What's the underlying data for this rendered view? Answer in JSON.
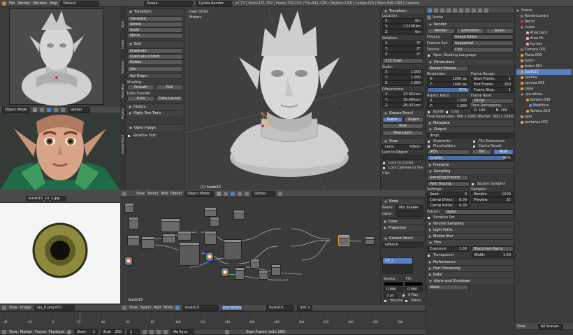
{
  "topbar": {
    "menus": [
      "File",
      "Render",
      "Window",
      "Help"
    ],
    "layout": "Default",
    "scene": "Scene",
    "engine": "Cycles Render",
    "stats": "v2.77 | Verts:471,762 | Faces:732,156 | Tris:941,728 | Objects:1/58 | Lamps:0/0 | Mem:548.10M | Camera"
  },
  "tool_shelf": {
    "transform_title": "Transform",
    "transform_buttons": [
      "Translate",
      "Rotate",
      "Scale",
      "Mirror"
    ],
    "edit_title": "Edit",
    "edit_buttons": [
      "Duplicate",
      "Duplicate Linked",
      "Delete",
      "Join"
    ],
    "set_origin": "Set Origin",
    "shading_title": "Shading:",
    "smooth": "Smooth",
    "flat": "Flat",
    "data_transfer": "Data Transfer",
    "data": "Data",
    "data_layout": "Data Layout",
    "history": "History",
    "rigify": "Rigify Dev Tools",
    "open_image_title": "Open Image",
    "relative_path": "Relative Path",
    "tabs": [
      "Tools",
      "Create",
      "Relations",
      "Animation",
      "Physics",
      "Grease Pencil",
      "Relations"
    ]
  },
  "viewport": {
    "view_label": "User Ortho",
    "units": "Meters",
    "object_label": "(1) busto15",
    "menus": [
      "View",
      "Select",
      "Add",
      "Object"
    ],
    "mode": "Object Mode",
    "pivot": "Global"
  },
  "camera_view": {
    "mode": "Object Mode",
    "pivot": "Global"
  },
  "npanel": {
    "transform_title": "Transform",
    "location_label": "Location:",
    "location": [
      [
        "X:",
        "0m"
      ],
      [
        "Y:",
        "-7.55083m"
      ],
      [
        "Z:",
        "0m"
      ]
    ],
    "rotation_label": "Rotation:",
    "rotation": [
      [
        "X:",
        "0°"
      ],
      [
        "Y:",
        "0°"
      ],
      [
        "Z:",
        "0°"
      ]
    ],
    "rotation_mode": "XYZ Euler",
    "scale_label": "Scale:",
    "scale": [
      [
        "X:",
        "1.000"
      ],
      [
        "Y:",
        "1.000"
      ],
      [
        "Z:",
        "1.000"
      ]
    ],
    "dimensions_label": "Dimensions:",
    "dimensions": [
      [
        "X:",
        "23.351cm"
      ],
      [
        "Y:",
        "16.405cm"
      ],
      [
        "Z:",
        "28.021cm"
      ]
    ],
    "grease_title": "Grease Pencil",
    "scene_btn": "Scene",
    "object_btn": "Object",
    "new_btn": "New",
    "new_layer_btn": "New Layer",
    "view_title": "View",
    "lens_label": "Lens:",
    "lens_value": "50mm",
    "lock_label": "Lock to Object:",
    "lock_cursor": "Lock to Cursor",
    "lock_camera": "Lock Camera to View",
    "clip": "Clip:"
  },
  "properties": {
    "scene_path": "Scene",
    "render_title": "Render",
    "render_tabs": [
      "Render",
      "Animation",
      "Audio"
    ],
    "display_label": "Display:",
    "display_value": "Image Editor",
    "feature_label": "Feature Set:",
    "feature_value": "Supported",
    "device_label": "Device:",
    "device_value": "CPU",
    "osl": "Open Shading Language",
    "dimensions_title": "Dimensions",
    "render_presets": "Render Presets",
    "resolution_label": "Resolution:",
    "res_x": "1200 px",
    "res_y": "1440 px",
    "res_pct": "50%",
    "frame_range_label": "Frame Range:",
    "start_frame": "1",
    "end_frame": "250",
    "frame_step": "1",
    "aspect_label": "Aspect Ratio:",
    "aspect_x": "1.000",
    "aspect_y": "1.000",
    "frame_rate_label": "Frame Rate:",
    "fps": "24 fps",
    "time_remap_label": "Time Remapping:",
    "old": "O: 100",
    "new": "N: 100",
    "border": "Borde",
    "crop": "Crop",
    "final_res": "Final Resolution: 900 x 1080 (Border: 900 x 1080)",
    "metadata_title": "Metadata",
    "output_title": "Output",
    "output_path": "/tmp\\",
    "overwrite": "Overwrite",
    "file_ext": "File Extensions",
    "placeholders": "Placeholders",
    "cache_result": "Cache Result",
    "format": "JPEG",
    "bw": "BW",
    "rgb": "RGB",
    "quality_label": "Quality:",
    "quality": "90%",
    "freestyle_title": "Freestyle",
    "sampling_title": "Sampling",
    "sampling_presets": "Sampling Presets",
    "path_tracing": "Path Tracing",
    "square_samples": "Square Samples",
    "settings_label": "Settings:",
    "samples_label": "Samples:",
    "seed": "0",
    "render_samples": "1500",
    "clamp_direct": "0.00",
    "preview_samples": "32",
    "clamp_indirect": "0.00",
    "pattern_label": "Pattern:",
    "pattern": "Sobol",
    "samples_per": "Samples Per",
    "volume_sampling": "Volume Sampling",
    "light_paths": "Light Paths",
    "motion_blur": "Motion Blur",
    "film_title": "Film",
    "exposure_label": "Exposure:",
    "exposure": "1.00",
    "filter": "Blackman-Harris",
    "transparent": "Transparent",
    "width_label": "Width:",
    "width": "1.50",
    "performance": "Performance",
    "post_processing": "Post Processing",
    "bake": "Bake",
    "alarm": "Alarm and Shutdown",
    "mario": "Mario"
  },
  "outliner": {
    "items": [
      "Scene",
      "RenderLayers",
      "World",
      "luces",
      "Area.back",
      "Area.fill",
      "luz.key",
      "Camera.001",
      "Plane.000",
      "boton",
      "boton.001",
      "busto15",
      "camisa",
      "camisa.001",
      "cejas",
      "ojo.retina",
      "Sphere.009",
      "Modifiers",
      "Sphere.010",
      "pelo",
      "pestañas.001"
    ],
    "footer_view": "View",
    "footer_search": "All Scenes"
  },
  "image_editor": {
    "name": "busto15_14_1.jpg",
    "menus": [
      "View",
      "Image"
    ],
    "image_name": "ojo_D.png.001"
  },
  "node_editor": {
    "menus": [
      "View",
      "Select",
      "Add",
      "Node"
    ],
    "material": "busto15",
    "use_nodes": "Use Nodes",
    "object_label": "busto15",
    "slot": "Slot 1",
    "panel_node_title": "Node",
    "name_label": "Name:",
    "name_value": "Mix Shader",
    "label_label": "Label:",
    "color_title": "Color",
    "properties_title": "Properties",
    "grease_title": "Grease Pencil",
    "gpencil": "GPencil",
    "gp_layer": "GP_L",
    "stroke_label": "Stroke:",
    "fill_label": "Fill:",
    "stroke_val": "0.900",
    "fill_val": "0.000",
    "thickness": "3 px",
    "xray": "X Ray",
    "volume": "Volume",
    "points": "Points"
  },
  "timeline": {
    "ticks": [
      "-40",
      "-20",
      "0",
      "20",
      "40",
      "60",
      "80",
      "100",
      "120",
      "140",
      "160",
      "180",
      "200",
      "220",
      "240",
      "260",
      "280"
    ],
    "menus": [
      "View",
      "Marker",
      "Frame",
      "Playback"
    ],
    "start": "Start:",
    "start_val": "1",
    "end": "End:",
    "end_val": "250",
    "current": "1",
    "sync": "No Sync",
    "status": "Start Frame (with 280)"
  },
  "colors": {
    "accent": "#5680c2",
    "orange_select": "#f0a030",
    "bg": "#393939"
  }
}
